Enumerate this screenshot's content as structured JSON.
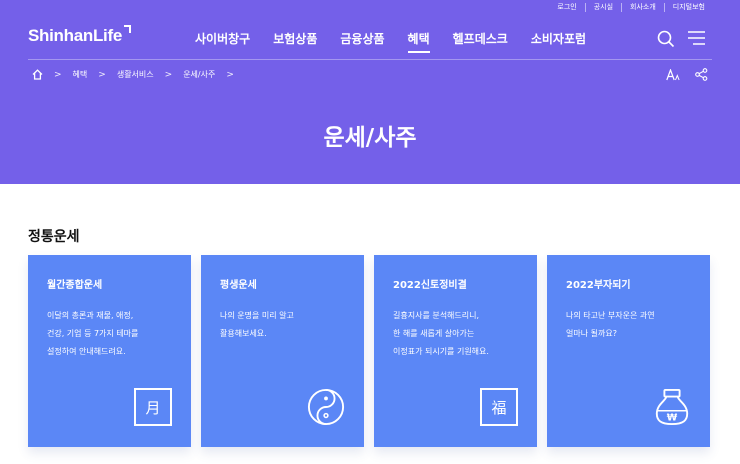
{
  "header": {
    "utility_links": [
      "로그인",
      "공시실",
      "회사소개",
      "디지털보험"
    ],
    "logo": "ShinhanLife",
    "nav": [
      {
        "label": "사이버창구",
        "active": false
      },
      {
        "label": "보험상품",
        "active": false
      },
      {
        "label": "금융상품",
        "active": false
      },
      {
        "label": "혜택",
        "active": true
      },
      {
        "label": "헬프데스크",
        "active": false
      },
      {
        "label": "소비자포럼",
        "active": false
      }
    ],
    "icons": [
      "search-icon",
      "menu-icon"
    ]
  },
  "breadcrumb": {
    "home_icon": "home-icon",
    "items": [
      "혜택",
      "생활서비스",
      "운세/사주"
    ],
    "tools": [
      "font-size-icon",
      "share-icon"
    ]
  },
  "page": {
    "title": "운세/사주",
    "section_title": "정통운세"
  },
  "cards": [
    {
      "title": "월간종합운세",
      "desc": [
        "이달의 총론과 재물, 애정,",
        "건강, 기업 등 7가지 테마를",
        "설정하여 안내해드려요."
      ],
      "icon": "calendar-moon-icon",
      "glyph": "月"
    },
    {
      "title": "평생운세",
      "desc": [
        "나의 운명을 미리 알고",
        "활용해보세요."
      ],
      "icon": "yin-yang-icon",
      "glyph": ""
    },
    {
      "title": "2022신토정비결",
      "desc": [
        "길흉지사를 분석해드리니,",
        "한 해를 새롭게 살아가는",
        "이정표가 되시기를 기원해요."
      ],
      "icon": "fortune-seal-icon",
      "glyph": "福"
    },
    {
      "title": "2022부자되기",
      "desc": [
        "나의 타고난 부자운은 과연",
        "얼마나 될까요?"
      ],
      "icon": "money-bag-icon",
      "glyph": "₩"
    }
  ],
  "colors": {
    "hero_bg": "#7460e9",
    "card_bg": "#5b87f6"
  }
}
